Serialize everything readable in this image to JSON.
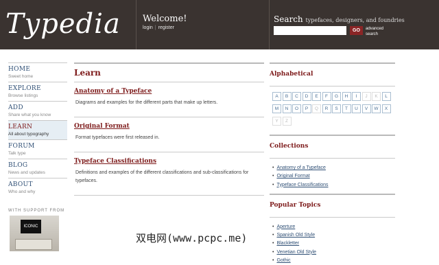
{
  "header": {
    "logo": "Typedia",
    "welcome": "Welcome!",
    "login": "login",
    "register": "register",
    "search_title": "Search",
    "search_hint": "typefaces, designers, and foundries",
    "search_placeholder": "",
    "go": "GO",
    "advanced_1": "advanced",
    "advanced_2": "search"
  },
  "nav": [
    {
      "label": "HOME",
      "sub": "Sweet home"
    },
    {
      "label": "EXPLORE",
      "sub": "Browse listings"
    },
    {
      "label": "ADD",
      "sub": "Share what you know"
    },
    {
      "label": "LEARN",
      "sub": "All about typography"
    },
    {
      "label": "FORUM",
      "sub": "Talk type"
    },
    {
      "label": "BLOG",
      "sub": "News and updates"
    },
    {
      "label": "ABOUT",
      "sub": "Who and why"
    }
  ],
  "support": {
    "label": "WITH SUPPORT FROM",
    "sponsor": "ICONIC"
  },
  "main": {
    "title": "Learn",
    "sections": [
      {
        "title": "Anatomy of a Typeface",
        "desc": "Diagrams and examples for the different parts that make up letters."
      },
      {
        "title": "Original Format",
        "desc": "Format typefaces were first released in."
      },
      {
        "title": "Typeface Classifications",
        "desc": "Definitions and examples of the different classifications and sub-classifications for typefaces."
      }
    ]
  },
  "right": {
    "alpha_title": "Alphabetical",
    "letters": [
      "A",
      "B",
      "C",
      "D",
      "E",
      "F",
      "G",
      "H",
      "I",
      "J",
      "K",
      "L",
      "M",
      "N",
      "O",
      "P",
      "Q",
      "R",
      "S",
      "T",
      "U",
      "V",
      "W",
      "X",
      "Y",
      "Z"
    ],
    "collections_title": "Collections",
    "collections": [
      "Anatomy of a Typeface",
      "Original Format",
      "Typeface Classifications"
    ],
    "topics_title": "Popular Topics",
    "topics": [
      "Aperture",
      "Spanish Old Style",
      "Blackletter",
      "Venetian Old Style",
      "Gothic"
    ]
  },
  "watermark": "双电网(www.pcpc.me)"
}
